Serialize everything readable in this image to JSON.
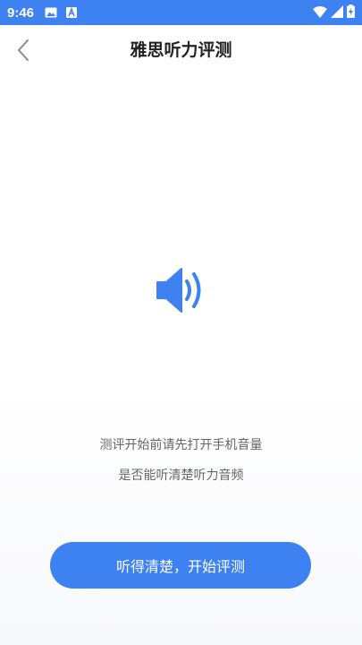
{
  "status_bar": {
    "time": "9:46",
    "icons": [
      "image-icon",
      "a-badge-icon",
      "wifi-icon",
      "signal-icon",
      "battery-charging-icon"
    ]
  },
  "header": {
    "title": "雅思听力评测",
    "back_icon": "chevron-left-icon"
  },
  "main": {
    "speaker_icon": "speaker-icon",
    "hint_line_1": "测评开始前请先打开手机音量",
    "hint_line_2": "是否能听清楚听力音频",
    "start_button_label": "听得清楚，开始评测"
  },
  "colors": {
    "accent": "#3d82f0",
    "title_text": "#222222",
    "hint_text": "#666666",
    "back_icon": "#8a8a8a"
  }
}
